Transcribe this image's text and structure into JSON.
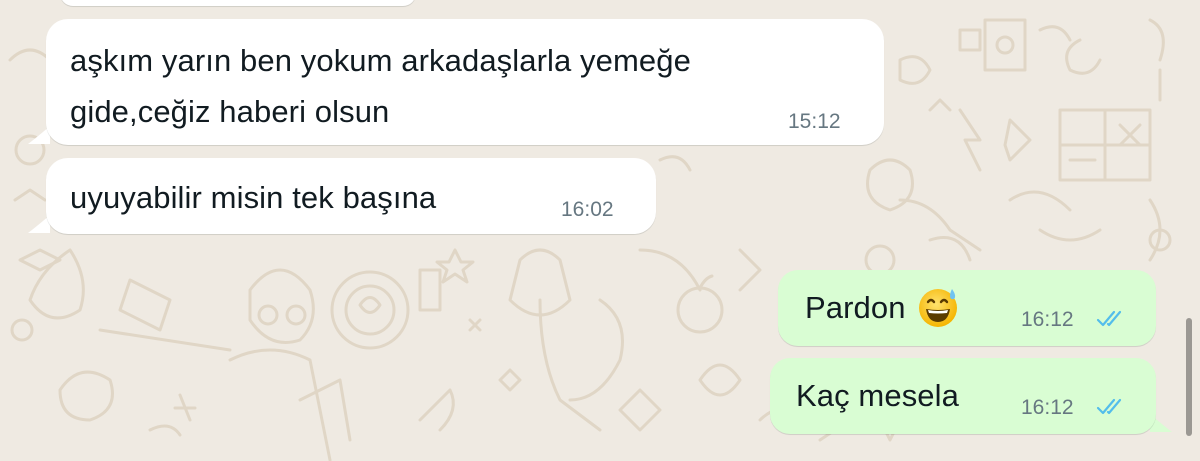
{
  "chat": {
    "messages": [
      {
        "direction": "in",
        "lines": [
          "aşkım yarın ben yokum arkadaşlarla yemeğe",
          "gide,ceğiz haberi olsun"
        ],
        "time": "15:12"
      },
      {
        "direction": "in",
        "lines": [
          "uyuyabilir misin tek başına"
        ],
        "time": "16:02"
      },
      {
        "direction": "out",
        "lines": [
          "Pardon"
        ],
        "emoji": "grinning-face-with-sweat",
        "time": "16:12",
        "status": "read"
      },
      {
        "direction": "out",
        "lines": [
          "Kaç mesela"
        ],
        "time": "16:12",
        "status": "read"
      }
    ]
  },
  "colors": {
    "background": "#efeae2",
    "incoming_bubble": "#ffffff",
    "outgoing_bubble": "#d9fdd3",
    "read_ticks": "#53bdeb",
    "timestamp": "#667781"
  }
}
